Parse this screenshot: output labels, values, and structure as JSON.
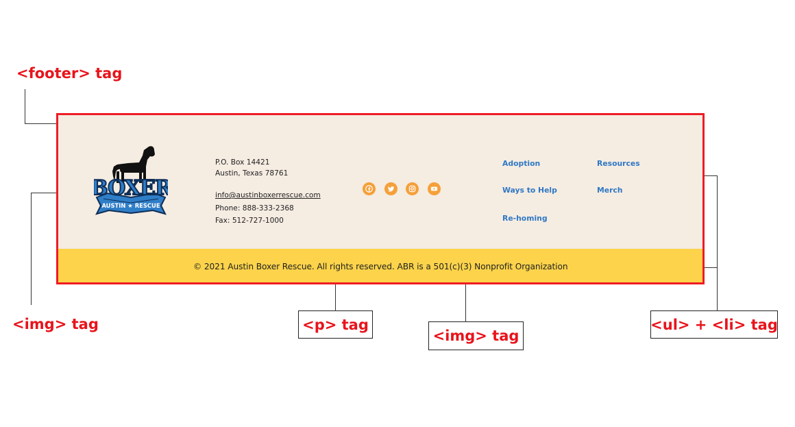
{
  "annotations": {
    "footer": "<footer> tag",
    "img_logo": "<img> tag",
    "p": "<p> tag",
    "img_social": "<img> tag",
    "list": "<ul>  + <li> tag"
  },
  "footer": {
    "contact": {
      "address_line1": "P.O. Box 14421",
      "address_line2": "Austin, Texas 78761",
      "email": "info@austinboxerrescue.com",
      "phone": "Phone: 888-333-2368",
      "fax": "Fax: 512-727-1000"
    },
    "logo": {
      "word": "BOXER",
      "banner_left": "AUSTIN",
      "banner_right": "RESCUE"
    },
    "social_icons": [
      "facebook-icon",
      "twitter-icon",
      "instagram-icon",
      "youtube-icon"
    ],
    "nav": {
      "col1": [
        "Adoption",
        "Ways to Help",
        "Re-homing"
      ],
      "col2": [
        "Resources",
        "Merch"
      ]
    },
    "copyright": "© 2021 Austin Boxer Rescue. All rights reserved. ABR is a 501(c)(3) Nonprofit Organization"
  },
  "colors": {
    "frame": "#ee1c24",
    "annotation_text": "#e8141b",
    "footer_bg": "#f5ece2",
    "bottom_bar": "#fcd34a",
    "link": "#2f78c4",
    "social": "#f5a03a",
    "logo_blue": "#2f7ec8"
  }
}
